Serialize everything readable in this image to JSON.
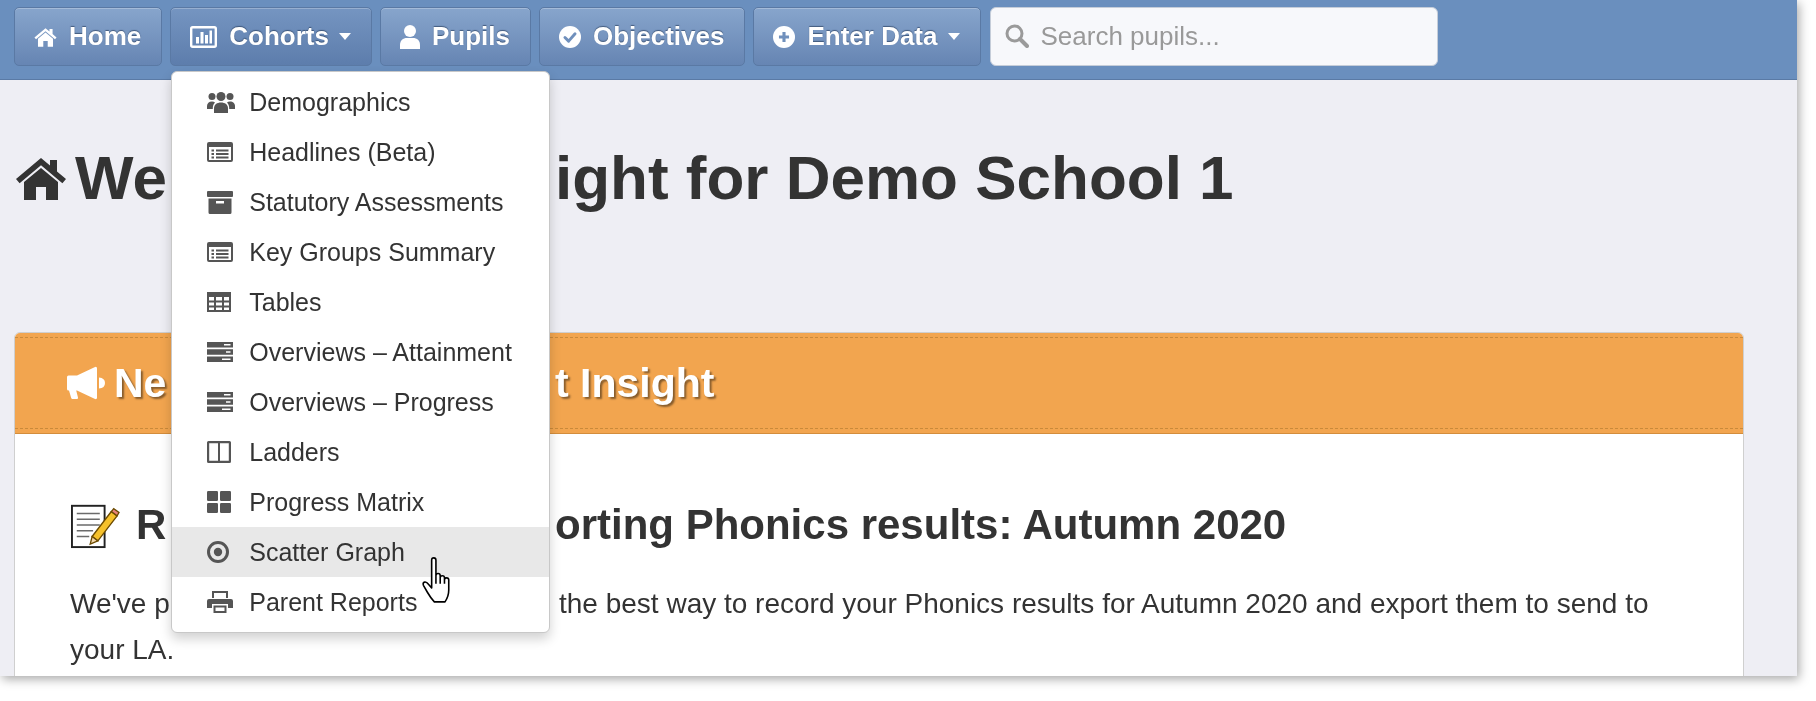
{
  "nav": {
    "buttons": [
      {
        "label": "Home",
        "kind": "link"
      },
      {
        "label": "Cohorts",
        "kind": "dropdown",
        "expanded": true,
        "menu": {
          "items": [
            {
              "label": "Demographics",
              "selected": false
            },
            {
              "label": "Headlines (Beta)",
              "selected": false
            },
            {
              "label": "Statutory Assessments",
              "selected": false
            },
            {
              "label": "Key Groups Summary",
              "selected": false
            },
            {
              "label": "Tables",
              "selected": false
            },
            {
              "label": "Overviews – Attainment",
              "selected": false
            },
            {
              "label": "Overviews – Progress",
              "selected": false
            },
            {
              "label": "Ladders",
              "selected": false
            },
            {
              "label": "Progress Matrix",
              "selected": false
            },
            {
              "label": "Scatter Graph",
              "selected": true
            },
            {
              "label": "Parent Reports",
              "selected": false
            }
          ]
        }
      },
      {
        "label": "Pupils",
        "kind": "link"
      },
      {
        "label": "Objectives",
        "kind": "link"
      },
      {
        "label": "Enter Data",
        "kind": "dropdown",
        "expanded": false
      }
    ],
    "search": {
      "placeholder": "Search pupils..."
    }
  },
  "page_title": {
    "parts": [
      "We",
      "ight for Demo School 1"
    ]
  },
  "notice": {
    "title_parts": [
      "Ne",
      "t Insight"
    ],
    "article": {
      "title_parts": [
        "R",
        "orting Phonics results: Autumn 2020"
      ],
      "lines": [
        [
          "We've p",
          "the best way to record your Phonics results for Autumn 2020 and export them to send to"
        ],
        [
          "your LA."
        ]
      ]
    }
  }
}
